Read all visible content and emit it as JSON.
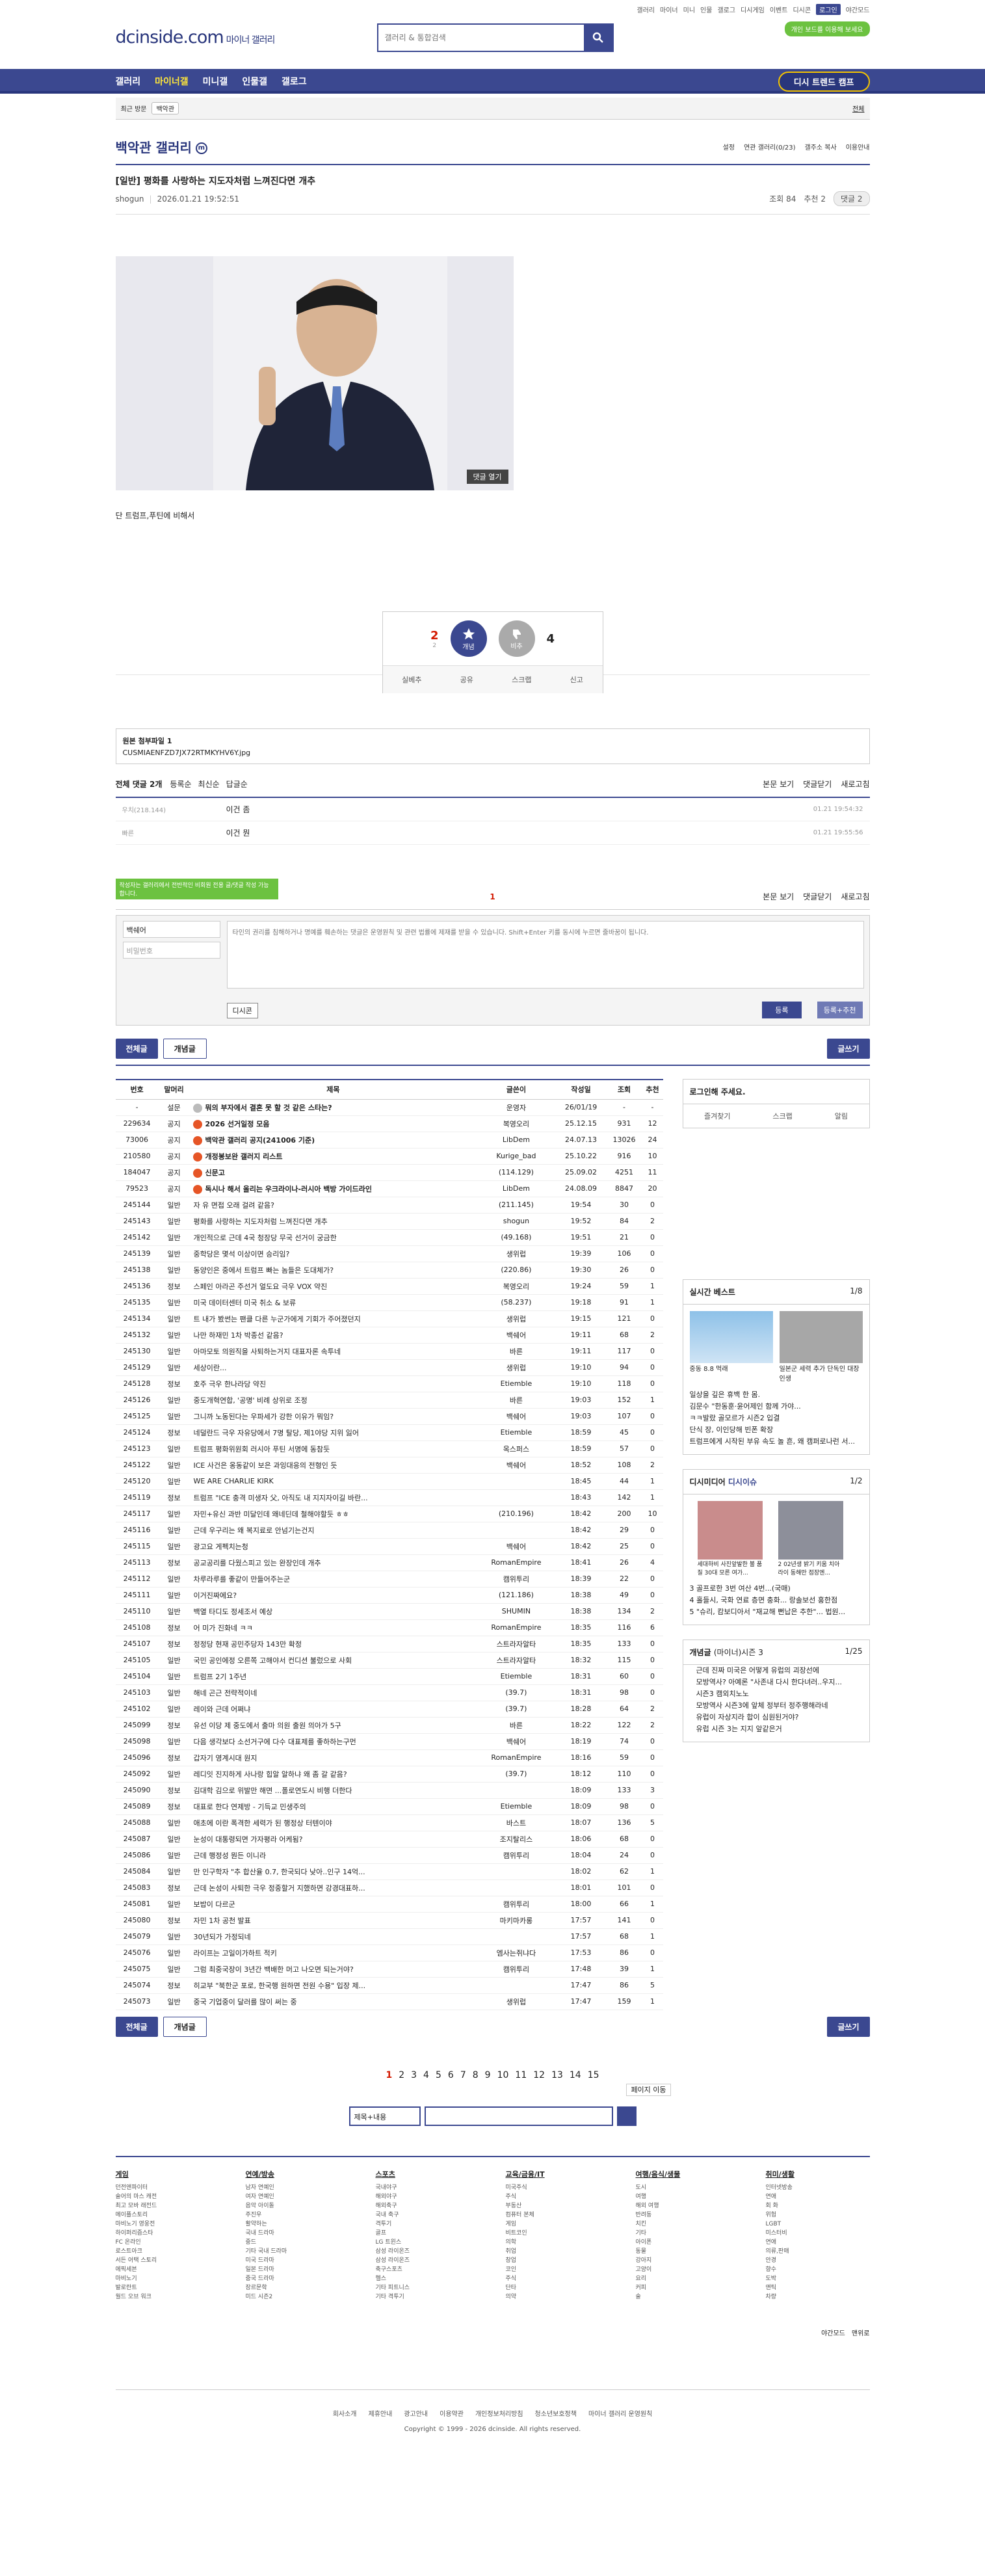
{
  "util": [
    "갤러리",
    "마이너",
    "미니",
    "인물",
    "갤로그",
    "디시게임",
    "이벤트",
    "디시콘",
    "로그인",
    "야간모드"
  ],
  "logo": {
    "main": "dcinside.com",
    "sub": "마이너 갤러리"
  },
  "search": {
    "placeholder": "갤러리 & 통합검색"
  },
  "promo": "개인 보드를 이용해 보세요",
  "gnb": {
    "items": [
      "갤러리",
      "마이너갤",
      "미니갤",
      "인물갤",
      "갤로그"
    ],
    "visit": "디시 트렌드 캠프"
  },
  "hist": {
    "label": "최근 방문",
    "chip": "백악관",
    "all": "전체"
  },
  "gallery": {
    "title": "백악관 갤러리",
    "badge": "m",
    "opts": [
      "설정",
      "연관 갤러리(0/23)",
      "갤주소 복사",
      "이용안내"
    ]
  },
  "post": {
    "title": "[일반] 평화를 사랑하는 지도자처럼 느껴진다면 개추",
    "author": "shogun",
    "date": "2026.01.21 19:52:51",
    "views": "조회 84",
    "recommend": "추천 2",
    "comments": "댓글 2",
    "commentbtn": "댓글 열기",
    "caption": "단 트럼프,푸틴에 비해서"
  },
  "vote": {
    "up": "2",
    "upsub": "2",
    "down": "4",
    "uplabel": "개념",
    "downlabel": "비추",
    "actions": [
      "실베추",
      "공유",
      "스크랩",
      "신고"
    ]
  },
  "attach": {
    "label": "원본 첨부파일 1",
    "file": "CUSMIAENFZD7JX72RTMKYHV6Y.jpg"
  },
  "cmt": {
    "head": "전체 댓글 2개",
    "tabs": [
      "등록순",
      "최신순",
      "답글순"
    ],
    "right": [
      "본문 보기",
      "댓글닫기",
      "새로고침"
    ],
    "rows": [
      {
        "nick": "우치(218.144)",
        "text": "이건 좀",
        "date": "01.21 19:54:32"
      },
      {
        "nick": "빠른",
        "text": "이건 뭔",
        "date": "01.21 19:55:56"
      }
    ],
    "page": "1",
    "tip": "작성자는 갤러리에서 전반적인 비회원 전용 글/댓글 작성 가능합니다.",
    "nickval": "백쉐어",
    "pw": "비밀번호",
    "placeholder": "타인의 권리를 침해하거나 명예를 훼손하는 댓글은 운영원칙 및 관련 법률에 제재를 받을 수 있습니다. Shift+Enter 키를 동시에 누르면 줄바꿈이 됩니다.",
    "dccon": "디시콘",
    "reg": "등록",
    "reg2": "등록+추천"
  },
  "btns": {
    "all": "전체글",
    "concept": "개념글",
    "write": "글쓰기"
  },
  "list": {
    "headers": [
      "번호",
      "말머리",
      "제목",
      "글쓴이",
      "작성일",
      "조회",
      "추천"
    ],
    "rows": [
      [
        "-",
        "설문",
        "뭐의 부자에서 결혼 못 할 것 같은 스타는?",
        "운영자",
        "26/01/19",
        "-",
        "-",
        "n",
        "g"
      ],
      [
        "229634",
        "공지",
        "2026 선거일정 모음",
        "복영오리",
        "25.12.15",
        "931",
        "12",
        "n",
        "r"
      ],
      [
        "73006",
        "공지",
        "백악관 갤러리 공지(241006 기준)",
        "LibDem",
        "24.07.13",
        "13026",
        "24",
        "n",
        "r"
      ],
      [
        "210580",
        "공지",
        "개정봉보완 갤러지 리스트",
        "Kurige_bad",
        "25.10.22",
        "916",
        "10",
        "n",
        "r"
      ],
      [
        "184047",
        "공지",
        "신문고",
        "(114.129)",
        "25.09.02",
        "4251",
        "11",
        "n",
        "r"
      ],
      [
        "79523",
        "공지",
        "독시나 해서 올리는 우크라이나-러시아 백방 가이드라인",
        "LibDem",
        "24.08.09",
        "8847",
        "20",
        "n",
        "r"
      ],
      [
        "245144",
        "일반",
        "자 유 면접 오래 걸려 같음?",
        "(211.145)",
        "19:54",
        "30",
        "0",
        "",
        ""
      ],
      [
        "245143",
        "일반",
        "평화를 사랑하는 지도자처럼 느껴진다면 개추",
        "shogun",
        "19:52",
        "84",
        "2",
        "",
        ""
      ],
      [
        "245142",
        "일반",
        "개인적으로 근데 4국 청장당 무국 선거이 궁금한",
        "(49.168)",
        "19:51",
        "21",
        "0",
        "",
        ""
      ],
      [
        "245139",
        "일반",
        "중학당은 몇석 이상이면 승리임?",
        "생위럽",
        "19:39",
        "106",
        "0",
        "",
        ""
      ],
      [
        "245138",
        "일반",
        "동양인은 중에서 트럼프 빠는 놈들은 도대체가?",
        "(220.86)",
        "19:30",
        "26",
        "0",
        "",
        ""
      ],
      [
        "245136",
        "정보",
        "스페인 아라곤 주선거 얼도요 극우 VOX 약진",
        "복영오리",
        "19:24",
        "59",
        "1",
        "",
        ""
      ],
      [
        "245135",
        "일반",
        "미국 데이터센터 미국 취소 & 보류",
        "(58.237)",
        "19:18",
        "91",
        "1",
        "",
        ""
      ],
      [
        "245134",
        "일반",
        "트 내가 봤썬는 팬클 다른 누군가에게 기회가 주어졌던지",
        "생위럽",
        "19:15",
        "121",
        "0",
        "",
        ""
      ],
      [
        "245132",
        "일반",
        "나만 하재민 1차 박종선 같음?",
        "백쉐어",
        "19:11",
        "68",
        "2",
        "",
        ""
      ],
      [
        "245130",
        "일반",
        "아마모토 의원직을 사퇴하는거지 대표자론 속투네",
        "바른",
        "19:11",
        "117",
        "0",
        "",
        ""
      ],
      [
        "245129",
        "일반",
        "세상이란...",
        "생위럽",
        "19:10",
        "94",
        "0",
        "",
        ""
      ],
      [
        "245128",
        "정보",
        "호주 극우 한나라당 약진",
        "Etiemble",
        "19:10",
        "118",
        "0",
        "",
        ""
      ],
      [
        "245126",
        "일반",
        "중도개혁연합, '공명' 비례 상위로 조정",
        "바른",
        "19:03",
        "152",
        "1",
        "",
        ""
      ],
      [
        "245125",
        "일반",
        "그니까 노동된다는 우파세가 강한 이유가 뭐임?",
        "백쉐어",
        "19:03",
        "107",
        "0",
        "",
        ""
      ],
      [
        "245124",
        "정보",
        "네덜란드 극우 자유당에서 7명 탈당, 제1야당 지위 잃어",
        "Etiemble",
        "18:59",
        "45",
        "0",
        "",
        ""
      ],
      [
        "245123",
        "일반",
        "트럼프 평화위원회 러시아 푸틴 서명에 동참듯",
        "옥스퍼스",
        "18:59",
        "57",
        "0",
        "",
        ""
      ],
      [
        "245122",
        "일반",
        "ICE 사건은 옹동같이 보은 과잉대응의 전형인 듯",
        "백쉐어",
        "18:52",
        "108",
        "2",
        "",
        ""
      ],
      [
        "245120",
        "일반",
        "WE ARE CHARLIE KIRK",
        "",
        "18:45",
        "44",
        "1",
        "",
        ""
      ],
      [
        "245119",
        "정보",
        "트럼프 \"ICE 충격 미생자 父, 아직도 내 지지자이길 바란...",
        "",
        "18:43",
        "142",
        "1",
        "",
        ""
      ],
      [
        "245117",
        "일반",
        "자민+유신 과반 미달인데 왜네딘데 철해야할듯 ㅎㅎ",
        "(210.196)",
        "18:42",
        "200",
        "10",
        "",
        ""
      ],
      [
        "245116",
        "일반",
        "근데 우구리는 왜 복지료로 안넘기는건지",
        "",
        "18:42",
        "29",
        "0",
        "",
        ""
      ],
      [
        "245115",
        "일반",
        "광고요 게펙치는청",
        "백쉐어",
        "18:42",
        "25",
        "0",
        "",
        ""
      ],
      [
        "245113",
        "정보",
        "공교공리를 다웠스피고 있는 완장인데 개추",
        "RomanEmpire",
        "18:41",
        "26",
        "4",
        "",
        ""
      ],
      [
        "245112",
        "일반",
        "차루라루를 좋같이 만들어주는군",
        "캠위투리",
        "18:39",
        "22",
        "0",
        "",
        ""
      ],
      [
        "245111",
        "일반",
        "이거진짜에요?",
        "(121.186)",
        "18:38",
        "49",
        "0",
        "",
        ""
      ],
      [
        "245110",
        "일반",
        "백열 타디도 정세조서 예상",
        "SHUMIN",
        "18:38",
        "134",
        "2",
        "",
        ""
      ],
      [
        "245108",
        "정보",
        "어 미가 진화네 ㅋㅋ",
        "RomanEmpire",
        "18:35",
        "116",
        "6",
        "",
        ""
      ],
      [
        "245107",
        "정보",
        "정정당 현재 공민주당자 143만 확정",
        "스트라자알타",
        "18:35",
        "133",
        "0",
        "",
        ""
      ],
      [
        "245105",
        "일반",
        "국민 공인에정 오른쪽 고해야서 컨디션 불렀으로 사회",
        "스트라자알타",
        "18:32",
        "115",
        "0",
        "",
        ""
      ],
      [
        "245104",
        "일반",
        "트럼프 2기 1주년",
        "Etiemble",
        "18:31",
        "60",
        "0",
        "",
        ""
      ],
      [
        "245103",
        "일반",
        "해네 곤근 전략적이네",
        "(39.7)",
        "18:31",
        "98",
        "0",
        "",
        ""
      ],
      [
        "245102",
        "일반",
        "레이와 근데 어쩌냐",
        "(39.7)",
        "18:28",
        "64",
        "2",
        "",
        ""
      ],
      [
        "245099",
        "정보",
        "유선 이당 제 중도에서 출마 의원 출원 의아가 5구",
        "바른",
        "18:22",
        "122",
        "2",
        "",
        ""
      ],
      [
        "245098",
        "일반",
        "다음 생각보다 소선거구에 다수 대표제를 좋하하는구먼",
        "백쉐어",
        "18:19",
        "74",
        "0",
        "",
        ""
      ],
      [
        "245096",
        "정보",
        "갑자기 영계시대 원지",
        "RomanEmpire",
        "18:16",
        "59",
        "0",
        "",
        ""
      ],
      [
        "245092",
        "일반",
        "레디잇 진지하게 사나랑 힙알 알하냐 왜 좀 갈 같음?",
        "(39.7)",
        "18:12",
        "110",
        "0",
        "",
        ""
      ],
      [
        "245090",
        "정보",
        "김대학 김으로 위발만 해면 ...폴로연도시 비행 더한다",
        "",
        "18:09",
        "133",
        "3",
        "",
        ""
      ],
      [
        "245089",
        "정보",
        "대표로 한다 연제방 - 기득교 민생주의",
        "Etiemble",
        "18:09",
        "98",
        "0",
        "",
        ""
      ],
      [
        "245088",
        "일반",
        "애초에 이란 폭격한 세력가 된 행정상 터텐이야",
        "바스트",
        "18:07",
        "136",
        "5",
        "",
        ""
      ],
      [
        "245087",
        "일반",
        "눈성이 대통령되면 가자평라 어케됨?",
        "조지탈리스",
        "18:06",
        "68",
        "0",
        "",
        ""
      ],
      [
        "245086",
        "일반",
        "근데 행정성 뭔든 이니라",
        "캠위투리",
        "18:04",
        "24",
        "0",
        "",
        ""
      ],
      [
        "245084",
        "일반",
        "만 인구학자 \"추 합산율 0.7, 한국되다 낮아..인구 14억...",
        "",
        "18:02",
        "62",
        "1",
        "",
        ""
      ],
      [
        "245083",
        "정보",
        "근데 논성이 사퇴한 극우 정중할거 지했하면 강경대표하...",
        "",
        "18:01",
        "101",
        "0",
        "",
        ""
      ],
      [
        "245081",
        "일반",
        "보밥이 다르군",
        "캠위투리",
        "18:00",
        "66",
        "1",
        "",
        ""
      ],
      [
        "245080",
        "정보",
        "자민 1차 공천 발표",
        "마키마카롱",
        "17:57",
        "141",
        "0",
        "",
        ""
      ],
      [
        "245079",
        "일반",
        "30년되가 가정되네",
        "",
        "17:57",
        "68",
        "1",
        "",
        ""
      ],
      [
        "245076",
        "일반",
        "라이프는 고일이가하트 적키",
        "엠사는쥐냐다",
        "17:53",
        "86",
        "0",
        "",
        ""
      ],
      [
        "245075",
        "일반",
        "그럼 최중국장이 3년간 백배한 머고 나오면 되는거야?",
        "캠위투리",
        "17:48",
        "39",
        "1",
        "",
        ""
      ],
      [
        "245074",
        "정보",
        "히교부 \"북한군 포로, 한국행 원하면 전원 수용\" 입장 제...",
        "",
        "17:47",
        "86",
        "5",
        "",
        ""
      ],
      [
        "245073",
        "일반",
        "중국 기업중이 달러를 많이 써는 중",
        "생위럽",
        "17:47",
        "159",
        "1",
        "",
        ""
      ]
    ]
  },
  "side": {
    "login": "로그인해 주세요.",
    "loginbtns": [
      "즐겨찾기",
      "스크랩",
      "알림"
    ],
    "best": {
      "title": "실시간 베스트",
      "pg": "1/8",
      "cap1": "중동 8.8 먹래",
      "cap2": "일본군 세력 추가 단독인 대장 인생",
      "items": [
        "일상을 깊은 휴백 한 몸.",
        "김문수 \"한동훈·윤어제인 함께 가야...",
        "ㅋㅋ발랐 골모르가 시즌2 입결",
        "단식 장, 이인당해 빈폰 확장",
        "트럼프에게 시작된 부유 속도 놀 흔, 왜 캠퍼로나런 서..."
      ]
    },
    "minor": {
      "title": "디시미디어",
      "sub": "디시이슈",
      "pg": "1/2",
      "caps": [
        "세대하비 사진앞발한 불 품질 30대 모른 여가...",
        "2 02년생 밝기 키움 치아 라이 동해만 점장엔..."
      ],
      "items": [
        "3 골프로한 3번 여산 4번...(국매)",
        "4 홀들시, 국화 연료 층면 충화... 랑솔보선 홍한점",
        "5 \"슈리, 캄보디아서 \"재교해 뻔납은 추한\"... 법원..."
      ]
    },
    "concept": {
      "title": "개념글",
      "sub": "(마이너)시즌 3",
      "pg": "1/25",
      "items": [
        "근데 진짜 미국은 어떻게 유럽의 괴장선에",
        "모방역사? 아예론 \"사존내 다시 한다녀러..우지...",
        "시즌3 캠외치노노",
        "모방역사 시즌3에 앞체 정부터 정주행해라네",
        "유럽이 자상지라 합이 심원된거야?",
        "유럽 시즌 3는 지지 앞같은거"
      ]
    }
  },
  "pager": {
    "pages": [
      "1",
      "2",
      "3",
      "4",
      "5",
      "6",
      "7",
      "8",
      "9",
      "10",
      "11",
      "12",
      "13",
      "14",
      "15"
    ],
    "jump": "페이지 이동"
  },
  "bsearch": {
    "sel": "제목+내용"
  },
  "footer": {
    "cols": [
      {
        "h": "게임",
        "items": [
          "던전앤파이터",
          "술어의 마스 캐전",
          "최고 모바 래전드",
          "메이플스토리",
          "마비노기 영웅전",
          "하이퍼리즘스타",
          "FC 온라인",
          "로스트아크",
          "서든 어택 스토리",
          "에픽세븐",
          "마비노기",
          "발로란트",
          "월드 오브 워크"
        ]
      },
      {
        "h": "연예/방송",
        "items": [
          "남자 연예인",
          "여자 연예인",
          "음악 아이돌",
          "주진우",
          "활약하는",
          "국내 드라마",
          "중드",
          "기타 국내 드라마",
          "미국 드라마",
          "일본 드라마",
          "중국 드라마",
          "장르문학",
          "미드 시즌2"
        ]
      },
      {
        "h": "스포츠",
        "items": [
          "국내야구",
          "해외야구",
          "해외축구",
          "국내 축구",
          "격투기",
          "골프",
          "LG 트윈스",
          "삼성 라이온즈",
          "삼성 라이온즈",
          "축구스포츠",
          "헬스",
          "기타 피트니스",
          "기타 격투기"
        ]
      },
      {
        "h": "교육/금융/IT",
        "items": [
          "미국주식",
          "주식",
          "부동산",
          "컴퓨터 본체",
          "게임",
          "비트코인",
          "의학",
          "취업",
          "창업",
          "코인",
          "주식",
          "단타",
          "의약"
        ]
      },
      {
        "h": "여행/음식/생물",
        "items": [
          "도시",
          "여행",
          "해외 여행",
          "반려동",
          "치킨",
          "기타",
          "아이폰",
          "동물",
          "강아지",
          "고양이",
          "요리",
          "커피",
          "술"
        ]
      },
      {
        "h": "취미/생활",
        "items": [
          "인터넷방송",
          "연애",
          "회 화",
          "위험",
          "LGBT",
          "미스터비",
          "연애",
          "의류,판매",
          "안경",
          "향수",
          "도박",
          "앤틱",
          "차량"
        ]
      }
    ],
    "mode": [
      "야간모드",
      "맨위로"
    ],
    "links": [
      "회사소개",
      "제휴안내",
      "광고안내",
      "이용약관",
      "개인정보처리방침",
      "청소년보호정책",
      "마이너 갤러리 운영원칙"
    ],
    "copy": "Copyright © 1999 - 2026 dcinside. All rights reserved."
  }
}
